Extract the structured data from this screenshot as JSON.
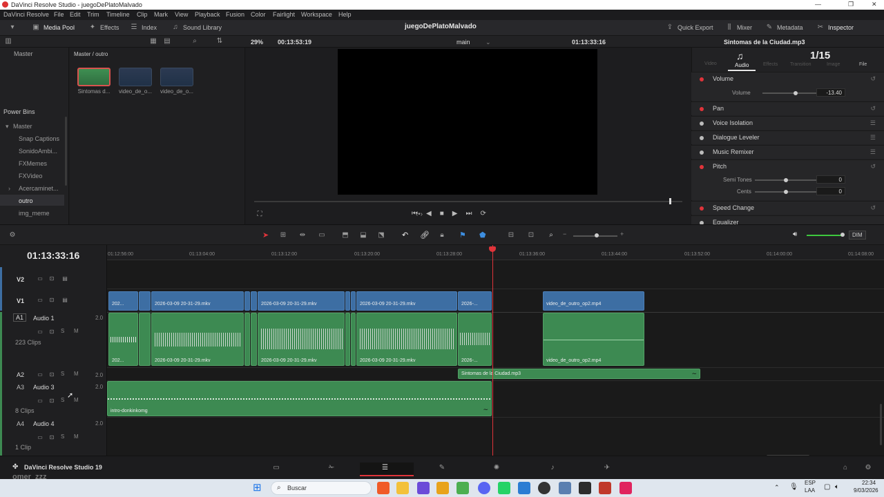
{
  "titlebar": {
    "title": "DaVinci Resolve Studio - juegoDePlatoMalvado",
    "min": "—",
    "max": "❐",
    "close": "✕"
  },
  "menu": [
    "DaVinci Resolve",
    "File",
    "Edit",
    "Trim",
    "Timeline",
    "Clip",
    "Mark",
    "View",
    "Playback",
    "Fusion",
    "Color",
    "Fairlight",
    "Workspace",
    "Help"
  ],
  "toolbar": {
    "media_pool": "Media Pool",
    "effects": "Effects",
    "index": "Index",
    "sound_library": "Sound Library",
    "project": "juegoDePlatoMalvado",
    "quick_export": "Quick Export",
    "mixer": "Mixer",
    "metadata": "Metadata",
    "inspector": "Inspector"
  },
  "subbar": {
    "zoom": "29%",
    "source_tc": "00:13:53:19",
    "timeline_name": "main",
    "record_tc": "01:13:33:16",
    "clip_name": "Sintomas de la Ciudad.mp3"
  },
  "bins": {
    "master": "Master",
    "power_bins": "Power Bins",
    "root": "Master",
    "items": [
      "Snap Captions",
      "SonidoAmbi...",
      "FXMemes",
      "FXVideo",
      "Acercaminet...",
      "outro",
      "img_meme"
    ]
  },
  "media": {
    "path": "Master / outro",
    "clips": [
      "Sintomas d...",
      "video_de_o...",
      "video_de_o..."
    ]
  },
  "inspector": {
    "tabs": [
      "Video",
      "Audio",
      "Effects",
      "Transition",
      "Image",
      "File"
    ],
    "page": "1/15",
    "volume": "Volume",
    "volume_sub": "Volume",
    "volume_val": "-13.40",
    "pan": "Pan",
    "voice_isolation": "Voice Isolation",
    "dialogue_leveler": "Dialogue Leveler",
    "music_remixer": "Music Remixer",
    "pitch": "Pitch",
    "semi_tones": "Semi Tones",
    "semi_val": "0",
    "cents": "Cents",
    "cents_val": "0",
    "speed_change": "Speed Change",
    "equalizer": "Equalizer"
  },
  "timeline": {
    "timecode": "01:13:33:16",
    "ruler": [
      "01:12:56:00",
      "01:13:04:00",
      "01:13:12:00",
      "01:13:20:00",
      "01:13:28:00",
      "01:13:36:00",
      "01:13:44:00",
      "01:13:52:00",
      "01:14:00:00",
      "01:14:08:00"
    ],
    "tracks": {
      "v2": "V2",
      "v1": "V1",
      "a1": "A1",
      "a1_name": "Audio 1",
      "a1_ch": "2.0",
      "a1_clips": "223 Clips",
      "a2": "A2",
      "a2_ch": "2.0",
      "a3": "A3",
      "a3_name": "Audio 3",
      "a3_ch": "2.0",
      "a3_clips": "8 Clips",
      "a4": "A4",
      "a4_name": "Audio 4",
      "a4_ch": "2.0",
      "a4_clips": "1 Clip"
    },
    "clip_short": "202...",
    "clip_mkv": "2026-03-09 20-31-29.mkv",
    "clip_short2": "2026-...",
    "outro": "video_de_outro_op2.mp4",
    "music": "Sintomas de la Ciudad.mp3",
    "intro": "intro-donkinkomg",
    "s": "S",
    "m": "M",
    "dim": "DIM"
  },
  "footer": {
    "app": "DaVinci Resolve Studio 19",
    "watermark": "omer_zzz"
  },
  "taskbar": {
    "search": "Buscar",
    "lang": "ESP",
    "lang2": "LAA",
    "time": "22:34",
    "date": "9/03/2026"
  }
}
